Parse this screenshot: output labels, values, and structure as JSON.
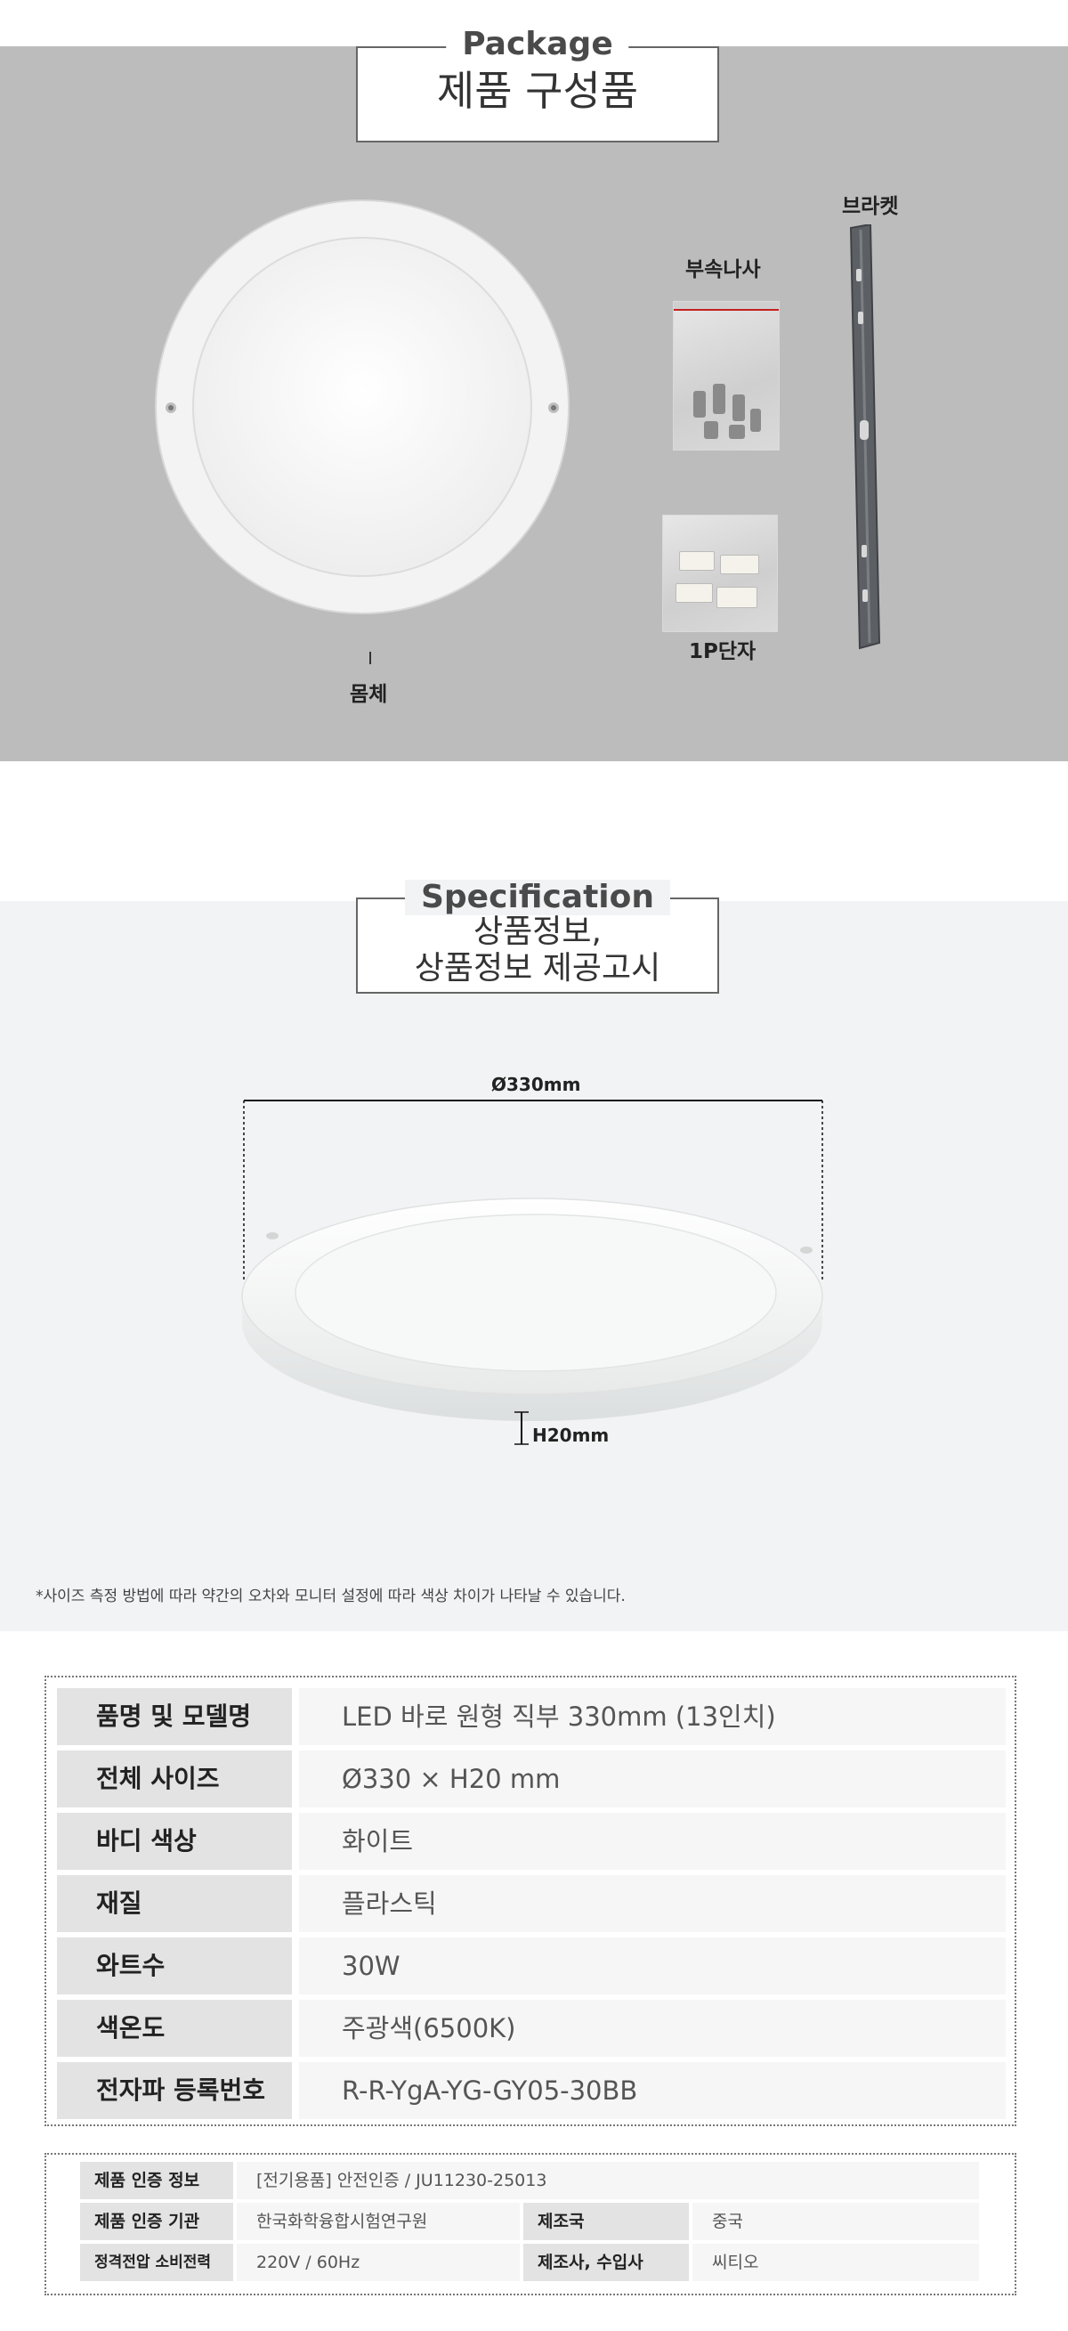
{
  "package": {
    "title_en": "Package",
    "title_ko": "제품 구성품",
    "parts": {
      "body": "몸체",
      "screws": "부속나사",
      "bracket": "브라켓",
      "terminal": "1P단자"
    }
  },
  "specification": {
    "title_en": "Specification",
    "title_ko_line1": "상품정보,",
    "title_ko_line2": "상품정보 제공고시",
    "diameter": "Ø330mm",
    "height": "H20mm",
    "disclaimer": "*사이즈 측정 방법에 따라 약간의 오차와 모니터 설정에 따라 색상 차이가 나타날 수 있습니다."
  },
  "spec_table": [
    {
      "key": "품명 및 모델명",
      "value": "LED 바로 원형 직부 330mm (13인치)"
    },
    {
      "key": "전체 사이즈",
      "value": "Ø330 × H20 mm"
    },
    {
      "key": "바디 색상",
      "value": "화이트"
    },
    {
      "key": "재질",
      "value": "플라스틱"
    },
    {
      "key": "와트수",
      "value": "30W"
    },
    {
      "key": "색온도",
      "value": "주광색(6500K)"
    },
    {
      "key": "전자파 등록번호",
      "value": "R-R-YgA-YG-GY05-30BB"
    }
  ],
  "cert_table": {
    "cert_info_key": "제품 인증 정보",
    "cert_info_value": "[전기용품] 안전인증 / JU11230-25013",
    "cert_org_key": "제품 인증 기관",
    "cert_org_value": "한국화학융합시험연구원",
    "country_key": "제조국",
    "country_value": "중국",
    "power_key": "정격전압 소비전력",
    "power_value": "220V / 60Hz",
    "maker_key": "제조사, 수입사",
    "maker_value": "씨티오"
  }
}
